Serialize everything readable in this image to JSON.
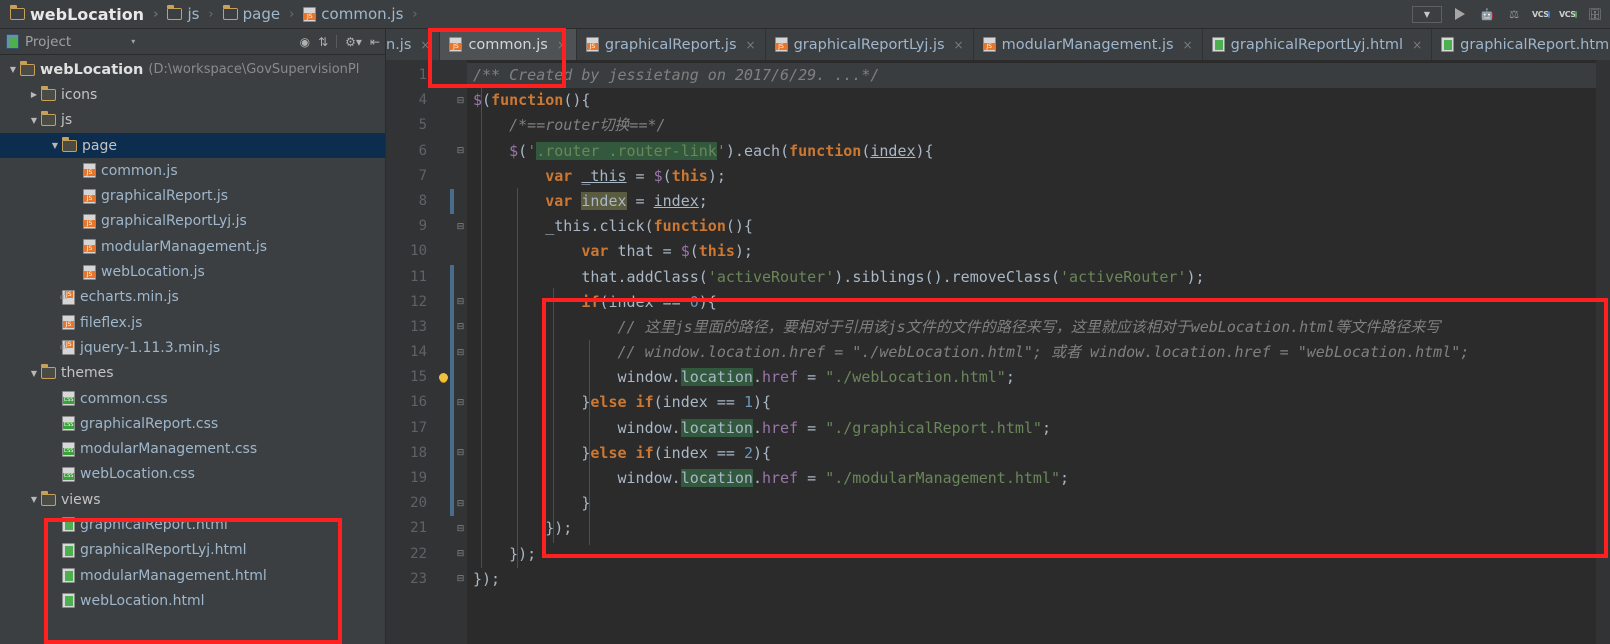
{
  "breadcrumb": {
    "items": [
      {
        "label": "webLocation",
        "icon": "folder-icon",
        "type": "folder-root"
      },
      {
        "label": "js",
        "icon": "folder-icon",
        "type": "folder"
      },
      {
        "label": "page",
        "icon": "folder-icon",
        "type": "folder"
      },
      {
        "label": "common.js",
        "icon": "js-file-icon",
        "type": "file"
      }
    ],
    "separator": "›"
  },
  "toolbar": {
    "run_config_label": "",
    "buttons": [
      {
        "name": "run-configuration-selector",
        "label": ""
      },
      {
        "name": "run-button",
        "label": ""
      },
      {
        "name": "debug-button",
        "label": ""
      },
      {
        "name": "coverage-button",
        "label": ""
      },
      {
        "name": "vcs-update-button",
        "label": "VCS"
      },
      {
        "name": "vcs-commit-button",
        "label": "VCS"
      },
      {
        "name": "vcs-history-button",
        "label": ""
      }
    ]
  },
  "project_panel": {
    "title": "Project",
    "caret": "▾",
    "tool_icons": [
      "collapse-all-icon",
      "expand-all-icon",
      "settings-gear-icon",
      "hide-panel-icon"
    ],
    "tree": [
      {
        "depth": 0,
        "arrow": "down",
        "label": "webLocation",
        "path": "(D:\\workspace\\GovSupervisionPl",
        "icon": "folder-icon",
        "kind": "root",
        "selected": false
      },
      {
        "depth": 1,
        "arrow": "right",
        "label": "icons",
        "icon": "folder-icon",
        "kind": "folder",
        "selected": false
      },
      {
        "depth": 1,
        "arrow": "down",
        "label": "js",
        "icon": "folder-icon",
        "kind": "folder",
        "selected": false
      },
      {
        "depth": 2,
        "arrow": "down",
        "label": "page",
        "icon": "folder-icon",
        "kind": "folder",
        "selected": true
      },
      {
        "depth": 3,
        "arrow": "none",
        "label": "common.js",
        "icon": "js-file-icon",
        "kind": "file",
        "selected": false
      },
      {
        "depth": 3,
        "arrow": "none",
        "label": "graphicalReport.js",
        "icon": "js-file-icon",
        "kind": "file",
        "selected": false
      },
      {
        "depth": 3,
        "arrow": "none",
        "label": "graphicalReportLyj.js",
        "icon": "js-file-icon",
        "kind": "file",
        "selected": false
      },
      {
        "depth": 3,
        "arrow": "none",
        "label": "modularManagement.js",
        "icon": "js-file-icon",
        "kind": "file",
        "selected": false
      },
      {
        "depth": 3,
        "arrow": "none",
        "label": "webLocation.js",
        "icon": "js-file-icon",
        "kind": "file",
        "selected": false
      },
      {
        "depth": 2,
        "arrow": "none",
        "label": "echarts.min.js",
        "icon": "minified-js-file-icon",
        "kind": "file-min",
        "selected": false
      },
      {
        "depth": 2,
        "arrow": "none",
        "label": "fileflex.js",
        "icon": "js-file-icon",
        "kind": "file",
        "selected": false
      },
      {
        "depth": 2,
        "arrow": "none",
        "label": "jquery-1.11.3.min.js",
        "icon": "minified-js-file-icon",
        "kind": "file-min",
        "selected": false
      },
      {
        "depth": 1,
        "arrow": "down",
        "label": "themes",
        "icon": "folder-icon",
        "kind": "folder",
        "selected": false
      },
      {
        "depth": 2,
        "arrow": "none",
        "label": "common.css",
        "icon": "css-file-icon",
        "kind": "file-css",
        "selected": false
      },
      {
        "depth": 2,
        "arrow": "none",
        "label": "graphicalReport.css",
        "icon": "css-file-icon",
        "kind": "file-css",
        "selected": false
      },
      {
        "depth": 2,
        "arrow": "none",
        "label": "modularManagement.css",
        "icon": "css-file-icon",
        "kind": "file-css",
        "selected": false
      },
      {
        "depth": 2,
        "arrow": "none",
        "label": "webLocation.css",
        "icon": "css-file-icon",
        "kind": "file-css",
        "selected": false
      },
      {
        "depth": 1,
        "arrow": "down",
        "label": "views",
        "icon": "folder-icon",
        "kind": "folder",
        "selected": false
      },
      {
        "depth": 2,
        "arrow": "none",
        "label": "graphicalReport.html",
        "icon": "html-file-icon",
        "kind": "file-html",
        "selected": false
      },
      {
        "depth": 2,
        "arrow": "none",
        "label": "graphicalReportLyj.html",
        "icon": "html-file-icon",
        "kind": "file-html",
        "selected": false
      },
      {
        "depth": 2,
        "arrow": "none",
        "label": "modularManagement.html",
        "icon": "html-file-icon",
        "kind": "file-html",
        "selected": false
      },
      {
        "depth": 2,
        "arrow": "none",
        "label": "webLocation.html",
        "icon": "html-file-icon",
        "kind": "file-html",
        "selected": false
      }
    ]
  },
  "editor_tabs": [
    {
      "label": "n.js",
      "icon": "js-file-icon",
      "active": false,
      "partial": true,
      "close": "×"
    },
    {
      "label": "common.js",
      "icon": "js-file-icon",
      "active": true,
      "partial": false,
      "close": "×"
    },
    {
      "label": "graphicalReport.js",
      "icon": "js-file-icon",
      "active": false,
      "partial": false,
      "close": "×"
    },
    {
      "label": "graphicalReportLyj.js",
      "icon": "js-file-icon",
      "active": false,
      "partial": false,
      "close": "×"
    },
    {
      "label": "modularManagement.js",
      "icon": "js-file-icon",
      "active": false,
      "partial": false,
      "close": "×"
    },
    {
      "label": "graphicalReportLyj.html",
      "icon": "html-file-icon",
      "active": false,
      "partial": false,
      "close": "×"
    },
    {
      "label": "graphicalReport.htm",
      "icon": "html-file-icon",
      "active": false,
      "partial": false,
      "close": ""
    }
  ],
  "code": {
    "line_numbers": [
      "1",
      "4",
      "5",
      "6",
      "7",
      "8",
      "9",
      "10",
      "11",
      "12",
      "13",
      "14",
      "15",
      "16",
      "17",
      "18",
      "19",
      "20",
      "21",
      "22",
      "23"
    ],
    "lines": [
      "/** Created by jessietang on 2017/6/29. ...*/",
      "$(function(){",
      "    /*==router切换==*/",
      "    $('.router .router-link').each(function(index){",
      "        var _this = $(this);",
      "        var index = index;",
      "        _this.click(function(){",
      "            var that = $(this);",
      "            that.addClass('activeRouter').siblings().removeClass('activeRouter');",
      "            if(index == 0){",
      "                // 这里js里面的路径，要相对于引用该js文件的文件的路径来写，这里就应该相对于webLocation.html等文件路径来写",
      "                // window.location.href = \"./webLocation.html\"; 或者 window.location.href = \"webLocation.html\";",
      "                window.location.href = \"./webLocation.html\";",
      "            }else if(index == 1){",
      "                window.location.href = \"./graphicalReport.html\";",
      "            }else if(index == 2){",
      "                window.location.href = \"./modularManagement.html\";",
      "            }",
      "        });",
      "    });",
      "});"
    ],
    "folded_line_indicator": "...",
    "intention_bulb": "lightbulb-icon"
  },
  "colors": {
    "editor_background": "#2b2b2b",
    "gutter_background": "#313335",
    "panel_background": "#3c3f41",
    "selection_blue": "#0d2d4e",
    "annotation_red": "#ff2020",
    "keyword_orange": "#cc7832",
    "string_green": "#6a8759",
    "comment_gray": "#808080",
    "number_blue": "#6897bb",
    "function_yellow": "#ffc66d",
    "property_purple": "#9876aa",
    "occurrence_highlight": "#32593d"
  },
  "annotations": [
    {
      "name": "highlight-box-active-tab"
    },
    {
      "name": "highlight-box-code-block"
    },
    {
      "name": "highlight-box-views-html-files"
    }
  ]
}
